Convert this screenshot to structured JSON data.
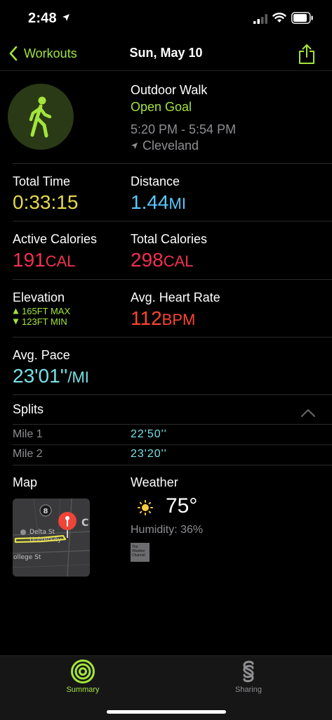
{
  "status_bar": {
    "time": "2:48"
  },
  "nav": {
    "back_label": "Workouts",
    "title": "Sun, May 10"
  },
  "header": {
    "workout_type": "Outdoor Walk",
    "goal": "Open Goal",
    "time_range": "5:20 PM - 5:54 PM",
    "location": "Cleveland"
  },
  "metrics": {
    "total_time": {
      "label": "Total Time",
      "value": "0:33:15"
    },
    "distance": {
      "label": "Distance",
      "value": "1.44",
      "unit": "MI"
    },
    "active_calories": {
      "label": "Active Calories",
      "value": "191",
      "unit": "CAL"
    },
    "total_calories": {
      "label": "Total Calories",
      "value": "298",
      "unit": "CAL"
    },
    "elevation": {
      "label": "Elevation",
      "max": "165FT MAX",
      "min": "123FT MIN"
    },
    "heart_rate": {
      "label": "Avg. Heart Rate",
      "value": "112",
      "unit": "BPM"
    },
    "pace": {
      "label": "Avg. Pace",
      "value": "23'01''",
      "unit": "/MI"
    }
  },
  "splits": {
    "title": "Splits",
    "rows": [
      {
        "mile": "Mile 1",
        "time": "22'50''"
      },
      {
        "mile": "Mile 2",
        "time": "23'20''"
      }
    ]
  },
  "map": {
    "label": "Map",
    "route_marker": "8",
    "street_labels": [
      "Delta St",
      "University",
      "ollege St",
      "C"
    ]
  },
  "weather": {
    "label": "Weather",
    "temperature": "75°",
    "humidity": "Humidity: 36%",
    "provider_logo_text": "The Weather Channel"
  },
  "tabs": [
    {
      "label": "Summary",
      "icon": "activity-rings-icon",
      "active": true
    },
    {
      "label": "Sharing",
      "icon": "sharing-icon",
      "active": false
    }
  ],
  "colors": {
    "accent_green": "#a4e43c",
    "time_yellow": "#e4d94c",
    "distance_blue": "#5ac8fa",
    "calorie_red": "#f2304e",
    "heart_red": "#fa4630",
    "pace_cyan": "#78e0e6"
  }
}
